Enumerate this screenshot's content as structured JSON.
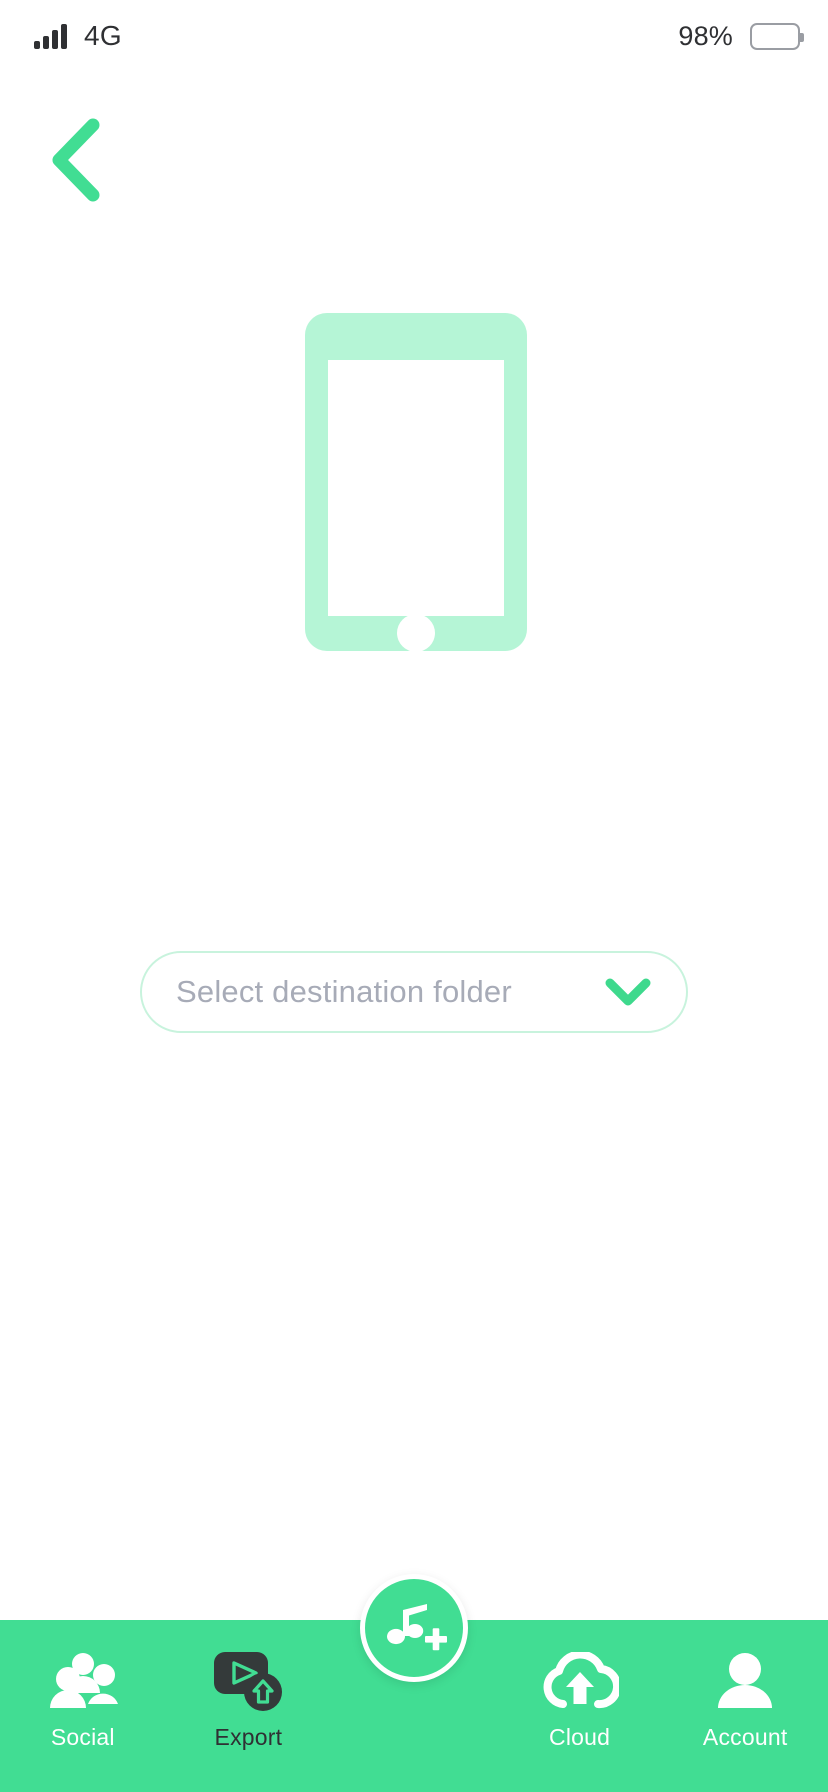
{
  "status_bar": {
    "signal_icon": "signal-bars-icon",
    "network": "4G",
    "battery_percent": "98%",
    "battery_icon": "battery-icon"
  },
  "header": {
    "back_icon": "chevron-left-icon"
  },
  "illustration": {
    "name": "phone-illustration",
    "color": "#b5f5d6"
  },
  "destination": {
    "placeholder": "Select destination folder",
    "value": "",
    "chevron_icon": "chevron-down-icon",
    "accent": "#3ed98d"
  },
  "fab": {
    "icon": "music-note-plus-icon",
    "label": "",
    "color": "#41dd93"
  },
  "bottom_nav": {
    "background": "#41dd93",
    "items": [
      {
        "label": "Social",
        "icon": "group-people-icon",
        "active": false
      },
      {
        "label": "Export",
        "icon": "video-export-icon",
        "active": true
      },
      {
        "label": "",
        "icon": "fab-spacer",
        "active": false
      },
      {
        "label": "Cloud",
        "icon": "cloud-upload-icon",
        "active": false
      },
      {
        "label": "Account",
        "icon": "person-icon",
        "active": false
      }
    ]
  }
}
